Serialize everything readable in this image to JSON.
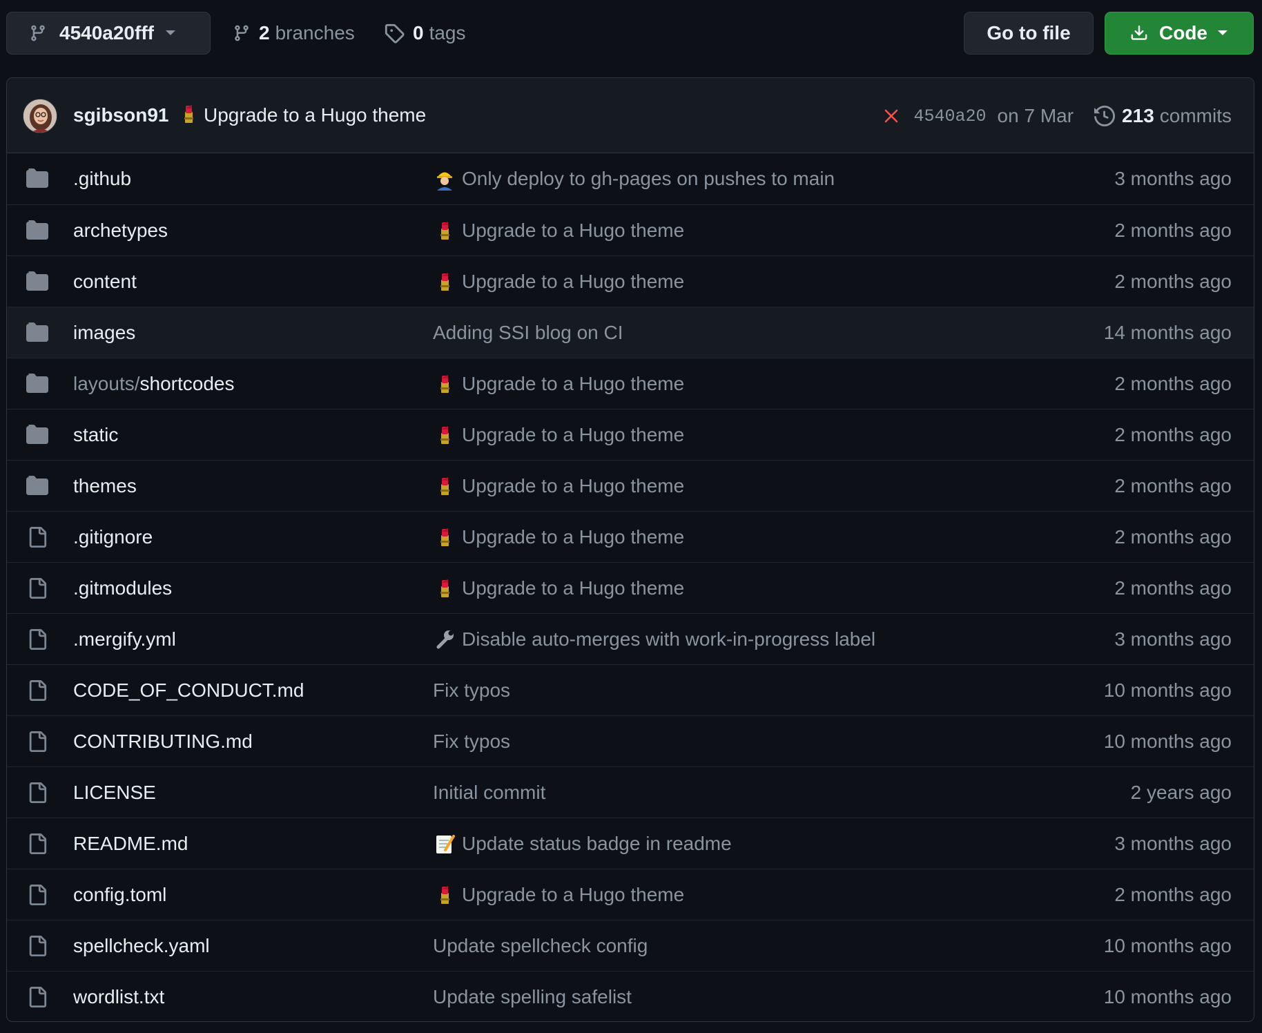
{
  "toolbar": {
    "branch_name": "4540a20fff",
    "branches_count": "2",
    "branches_label": "branches",
    "tags_count": "0",
    "tags_label": "tags",
    "go_to_file_label": "Go to file",
    "code_label": "Code"
  },
  "colors": {
    "background": "#0d1117",
    "header_bg": "#161b22",
    "border": "#30363d",
    "text": "#e6edf3",
    "muted": "#8b949e",
    "code_button": "#238636",
    "fail_red": "#f85149",
    "folder_icon": "#7d8590"
  },
  "latest_commit": {
    "author": "sgibson91",
    "emoji": "lipstick-icon",
    "message": "Upgrade to a Hugo theme",
    "status": "x-fail-icon",
    "sha": "4540a20",
    "date": "on 7 Mar",
    "commits_count": "213",
    "commits_label": "commits"
  },
  "files": [
    {
      "type": "folder",
      "prefix": "",
      "name": ".github",
      "emoji": "construction-worker-icon",
      "message": "Only deploy to gh-pages on pushes to main",
      "time": "3 months ago"
    },
    {
      "type": "folder",
      "prefix": "",
      "name": "archetypes",
      "emoji": "lipstick-icon",
      "message": "Upgrade to a Hugo theme",
      "time": "2 months ago"
    },
    {
      "type": "folder",
      "prefix": "",
      "name": "content",
      "emoji": "lipstick-icon",
      "message": "Upgrade to a Hugo theme",
      "time": "2 months ago"
    },
    {
      "type": "folder",
      "prefix": "",
      "name": "images",
      "emoji": "",
      "message": "Adding SSI blog on CI",
      "time": "14 months ago"
    },
    {
      "type": "folder",
      "prefix": "layouts/",
      "name": "shortcodes",
      "emoji": "lipstick-icon",
      "message": "Upgrade to a Hugo theme",
      "time": "2 months ago"
    },
    {
      "type": "folder",
      "prefix": "",
      "name": "static",
      "emoji": "lipstick-icon",
      "message": "Upgrade to a Hugo theme",
      "time": "2 months ago"
    },
    {
      "type": "folder",
      "prefix": "",
      "name": "themes",
      "emoji": "lipstick-icon",
      "message": "Upgrade to a Hugo theme",
      "time": "2 months ago"
    },
    {
      "type": "file",
      "prefix": "",
      "name": ".gitignore",
      "emoji": "lipstick-icon",
      "message": "Upgrade to a Hugo theme",
      "time": "2 months ago"
    },
    {
      "type": "file",
      "prefix": "",
      "name": ".gitmodules",
      "emoji": "lipstick-icon",
      "message": "Upgrade to a Hugo theme",
      "time": "2 months ago"
    },
    {
      "type": "file",
      "prefix": "",
      "name": ".mergify.yml",
      "emoji": "wrench-icon",
      "message": "Disable auto-merges with work-in-progress label",
      "time": "3 months ago"
    },
    {
      "type": "file",
      "prefix": "",
      "name": "CODE_OF_CONDUCT.md",
      "emoji": "",
      "message": "Fix typos",
      "time": "10 months ago"
    },
    {
      "type": "file",
      "prefix": "",
      "name": "CONTRIBUTING.md",
      "emoji": "",
      "message": "Fix typos",
      "time": "10 months ago"
    },
    {
      "type": "file",
      "prefix": "",
      "name": "LICENSE",
      "emoji": "",
      "message": "Initial commit",
      "time": "2 years ago"
    },
    {
      "type": "file",
      "prefix": "",
      "name": "README.md",
      "emoji": "memo-icon",
      "message": "Update status badge in readme",
      "time": "3 months ago"
    },
    {
      "type": "file",
      "prefix": "",
      "name": "config.toml",
      "emoji": "lipstick-icon",
      "message": "Upgrade to a Hugo theme",
      "time": "2 months ago"
    },
    {
      "type": "file",
      "prefix": "",
      "name": "spellcheck.yaml",
      "emoji": "",
      "message": "Update spellcheck config",
      "time": "10 months ago"
    },
    {
      "type": "file",
      "prefix": "",
      "name": "wordlist.txt",
      "emoji": "",
      "message": "Update spelling safelist",
      "time": "10 months ago"
    }
  ]
}
